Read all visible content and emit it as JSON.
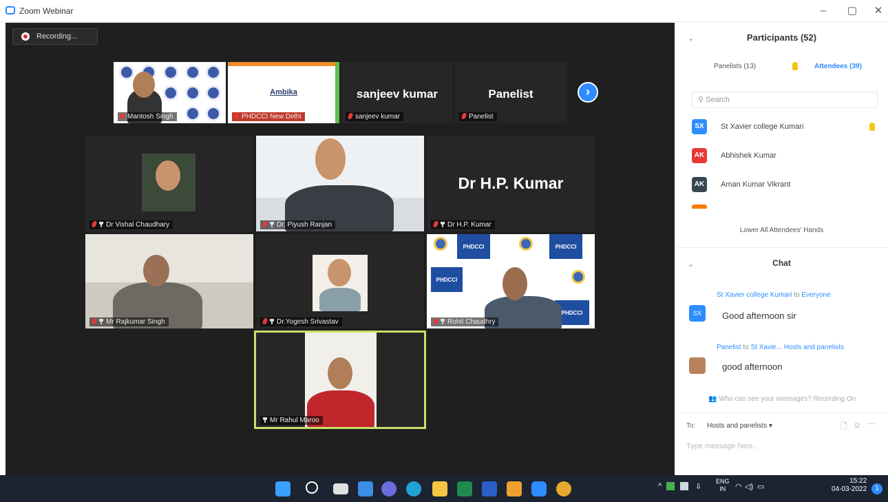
{
  "window": {
    "title": "Zoom Webinar"
  },
  "recording": {
    "label": "Recording..."
  },
  "tiles_top": [
    {
      "name": "Mantosh Singh"
    },
    {
      "name": "PHDCCI New Delhi",
      "slide_brand": "Ambika"
    },
    {
      "name": "sanjeev kumar",
      "display": "sanjeev kumar"
    },
    {
      "name": "Panelist",
      "display": "Panelist"
    }
  ],
  "tiles_main": [
    {
      "name": "Dr Vishal Chaudhary"
    },
    {
      "name": "Dr. Piyush Ranjan"
    },
    {
      "name": "Dr H.P. Kumar",
      "display": "Dr H.P. Kumar"
    },
    {
      "name": "Mr Rajkumar Singh"
    },
    {
      "name": "Dr.Yogesh Srivastav"
    },
    {
      "name": "Rohit Chaudhry",
      "banner": "PHDCCI"
    },
    {
      "name": "Mr Rahul Maroo"
    }
  ],
  "participants": {
    "title": "Participants (52)",
    "tab_panelists": "Panelists (13)",
    "tab_attendees": "Attendees (39)",
    "search_placeholder": "Search",
    "list": [
      {
        "initials": "SX",
        "name": "St Xavier college Kumari",
        "color": "#2d8cff"
      },
      {
        "initials": "AK",
        "name": "Abhishek Kumar",
        "color": "#e53935"
      },
      {
        "initials": "AK",
        "name": "Aman Kumar Vikrant",
        "color": "#37474f"
      }
    ],
    "lower_all": "Lower All Attendees' Hands"
  },
  "chat": {
    "title": "Chat",
    "messages": [
      {
        "initials": "SX",
        "from": "St Xavier college Kumari",
        "to_word": "to",
        "to": "Everyone",
        "text": "Good afternoon sir"
      },
      {
        "from": "Panelist",
        "to_word": "to",
        "to": "St Xavie... Hosts and panelists",
        "text": "good afternoon"
      }
    ],
    "who_can_see": "Who can see your messages? Recording On",
    "to_label": "To:",
    "to_value": "Hosts and panelists",
    "input_placeholder": "Type message here..."
  },
  "taskbar": {
    "lang_top": "ENG",
    "lang_bottom": "IN",
    "time": "15:22",
    "date": "04-03-2022",
    "notifications": "1"
  },
  "colors": {
    "zoom_blue": "#2d8cff",
    "stage_bg": "#1f1f1f",
    "active_speaker": "#c8e06a"
  }
}
